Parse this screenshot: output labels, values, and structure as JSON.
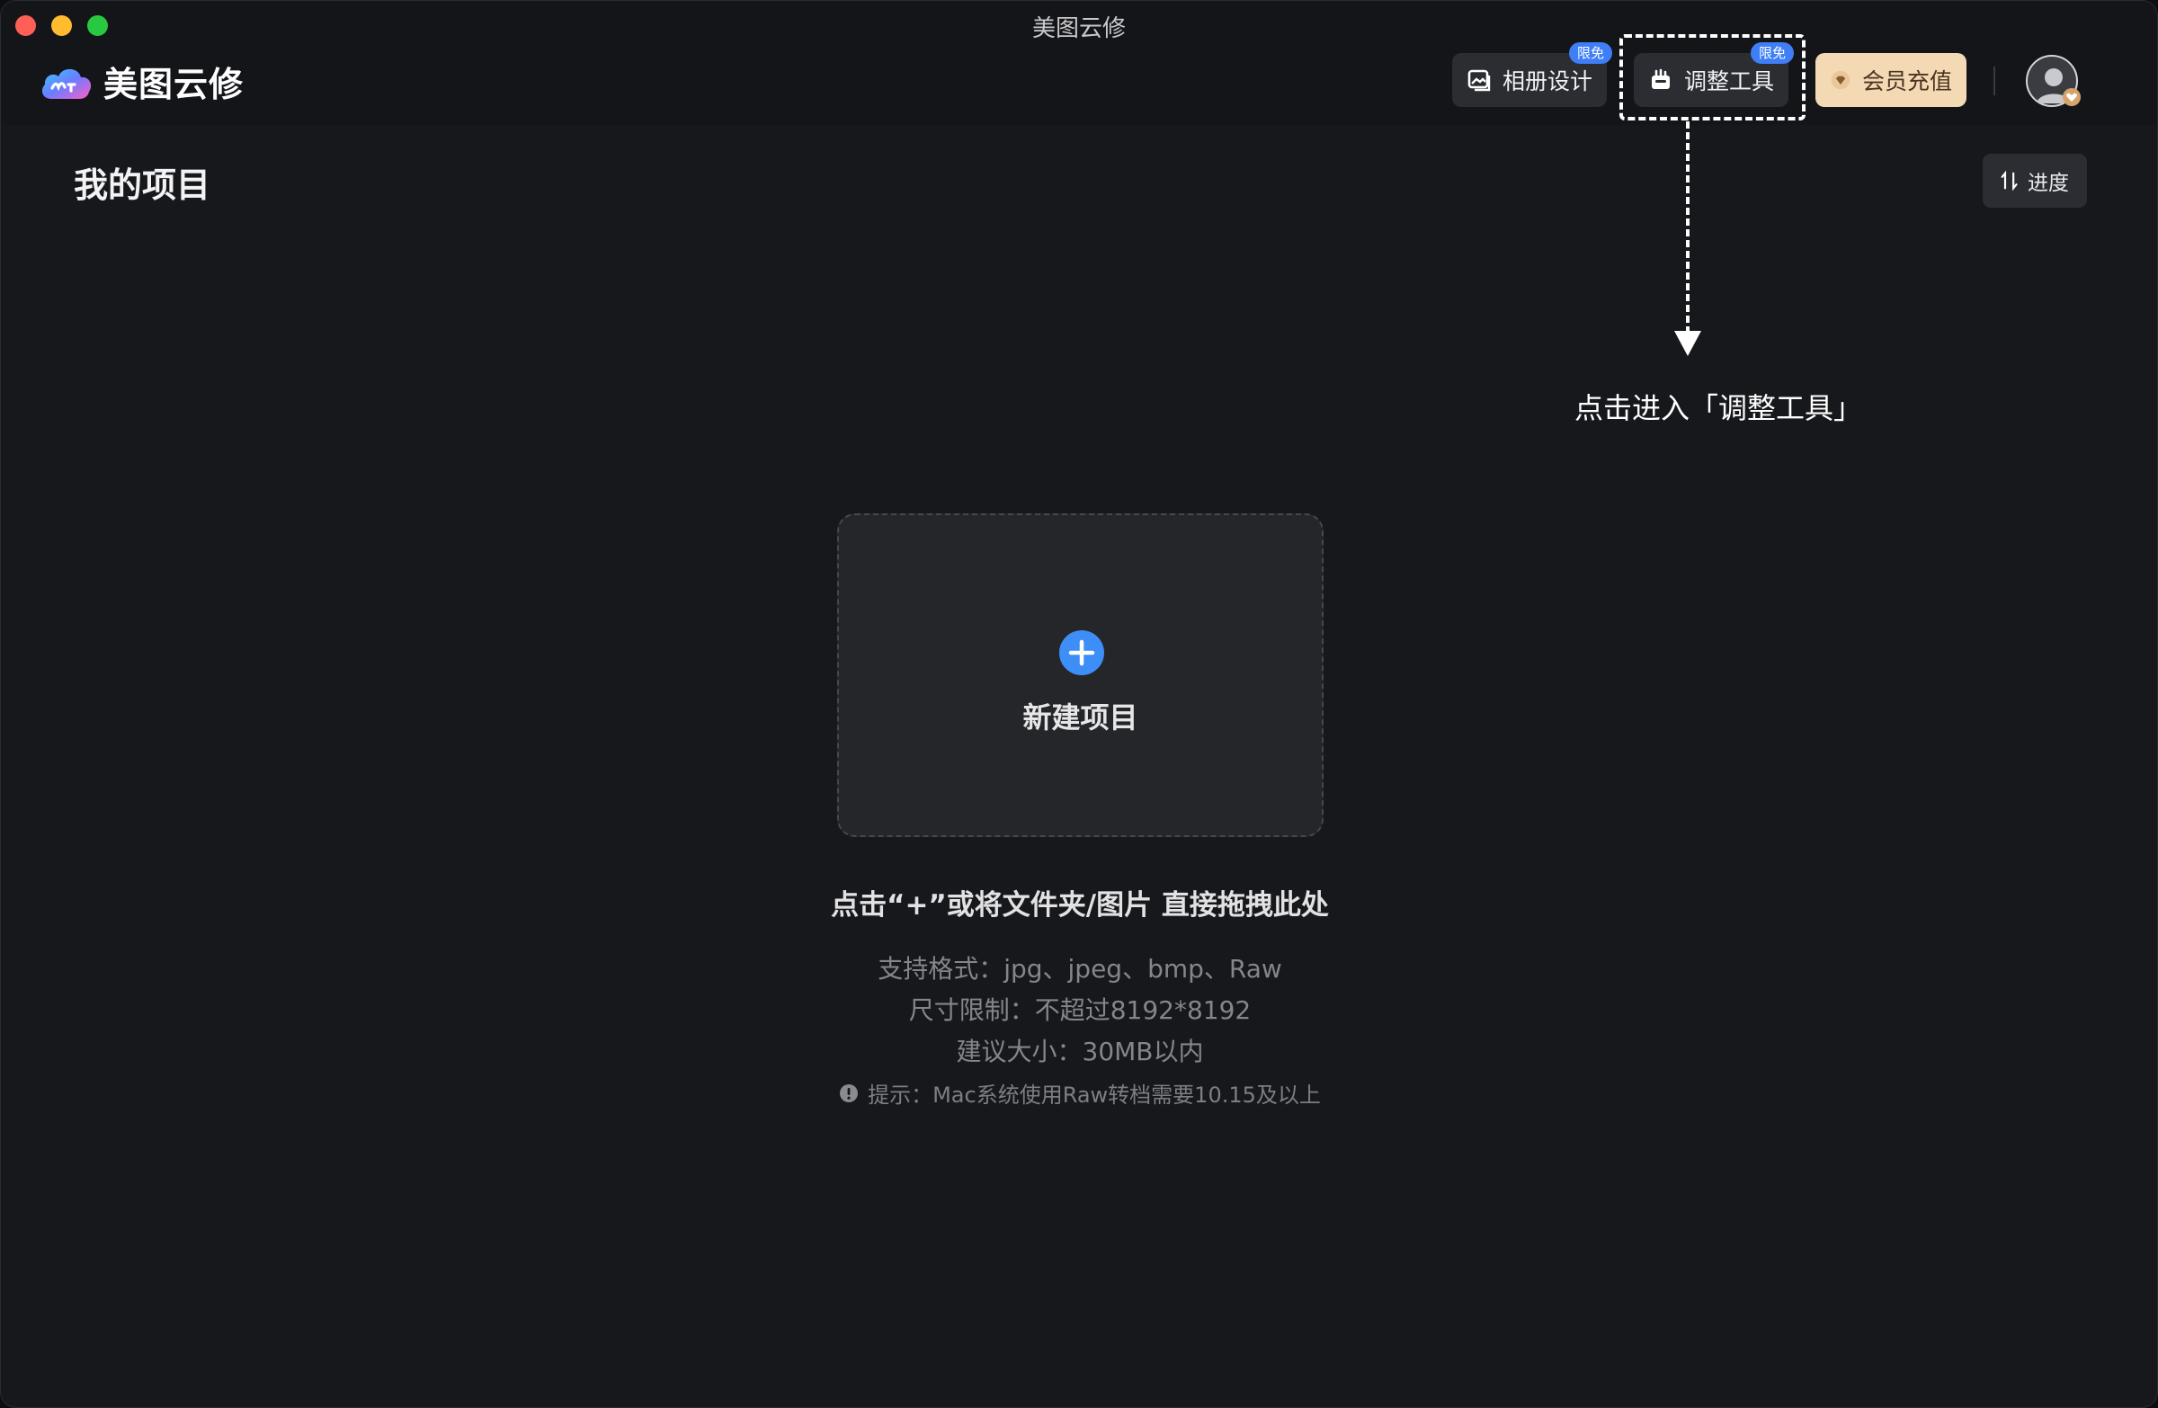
{
  "window": {
    "title": "美图云修"
  },
  "header": {
    "logo_text": "美图云修",
    "buttons": {
      "album": {
        "label": "相册设计",
        "badge": "限免"
      },
      "adjust": {
        "label": "调整工具",
        "badge": "限免"
      },
      "vip": {
        "label": "会员充值"
      }
    }
  },
  "main": {
    "title": "我的项目",
    "sort_label": "进度",
    "callout": "点击进入「调整工具」",
    "drop_zone": {
      "label": "新建项目"
    },
    "hints": {
      "main": "点击“+”或将文件夹/图片 直接拖拽此处",
      "formats": "支持格式：jpg、jpeg、bmp、Raw",
      "size_limit": "尺寸限制：不超过8192*8192",
      "recommended": "建议大小：30MB以内",
      "tip": "提示：Mac系统使用Raw转档需要10.15及以上"
    }
  },
  "colors": {
    "accent": "#3e8ef7",
    "badge": "#3e7ef7",
    "vip": "#f3d9b4",
    "background": "#17181c"
  },
  "icons": [
    "album-icon",
    "adjust-tool-icon",
    "diamond-icon",
    "user-avatar-icon",
    "sort-icon",
    "plus-icon",
    "exclamation-icon"
  ]
}
